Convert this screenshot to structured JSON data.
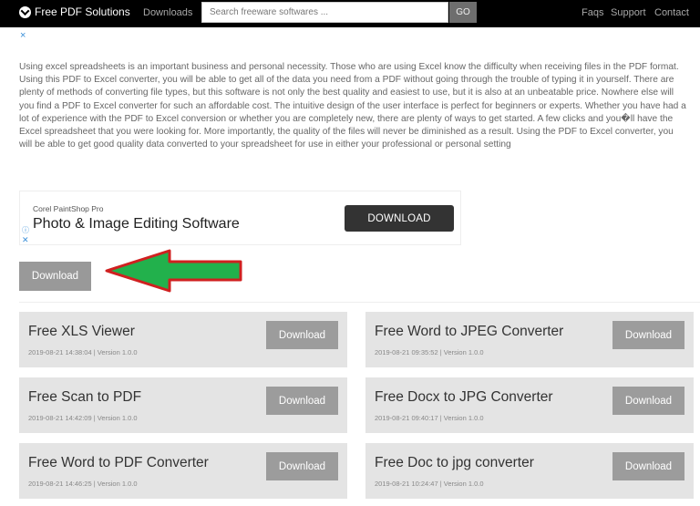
{
  "nav": {
    "brand": "Free PDF Solutions",
    "downloads": "Downloads",
    "search_placeholder": "Search freeware softwares ...",
    "go": "GO",
    "faqs": "Faqs",
    "support": "Support",
    "contact": "Contact"
  },
  "close_glyph": "×",
  "article": {
    "text": "Using excel spreadsheets is an important business and personal necessity. Those who are using Excel know the difficulty when receiving files in the PDF format. Using this PDF to Excel converter, you will be able to get all of the data you need from a PDF without going through the trouble of typing it in yourself. There are plenty of methods of converting file types, but this software is not only the best quality and easiest to use, but it is also at an unbeatable price. Nowhere else will you find a PDF to Excel converter for such an affordable cost. The intuitive design of the user interface is perfect for beginners or experts. Whether you have had a lot of experience with the PDF to Excel conversion or whether you are completely new, there are plenty of ways to get started. A few clicks and you�ll have the Excel spreadsheet that you were looking for. More importantly, the quality of the files will never be diminished as a result. Using the PDF to Excel converter, you will be able to get good quality data converted to your spreadsheet for use in either your professional or personal setting"
  },
  "ad": {
    "brand": "Corel PaintShop Pro",
    "title": "Photo & Image Editing Software",
    "button": "DOWNLOAD",
    "info_glyph": "ⓘ",
    "close_glyph": "✕"
  },
  "main_download": "Download",
  "arrow_colors": {
    "fill": "#22b14c",
    "stroke": "#d02020"
  },
  "cards": [
    {
      "title": "Free XLS Viewer",
      "meta": "2019-08-21 14:38:04 | Version 1.0.0",
      "button": "Download"
    },
    {
      "title": "Free Word to JPEG Converter",
      "meta": "2019-08-21 09:35:52 | Version 1.0.0",
      "button": "Download"
    },
    {
      "title": "Free Scan to PDF",
      "meta": "2019-08-21 14:42:09 | Version 1.0.0",
      "button": "Download"
    },
    {
      "title": "Free Docx to JPG Converter",
      "meta": "2019-08-21 09:40:17 | Version 1.0.0",
      "button": "Download"
    },
    {
      "title": "Free Word to PDF Converter",
      "meta": "2019-08-21 14:46:25 | Version 1.0.0",
      "button": "Download"
    },
    {
      "title": "Free Doc to jpg converter",
      "meta": "2019-08-21 10:24:47 | Version 1.0.0",
      "button": "Download"
    }
  ]
}
